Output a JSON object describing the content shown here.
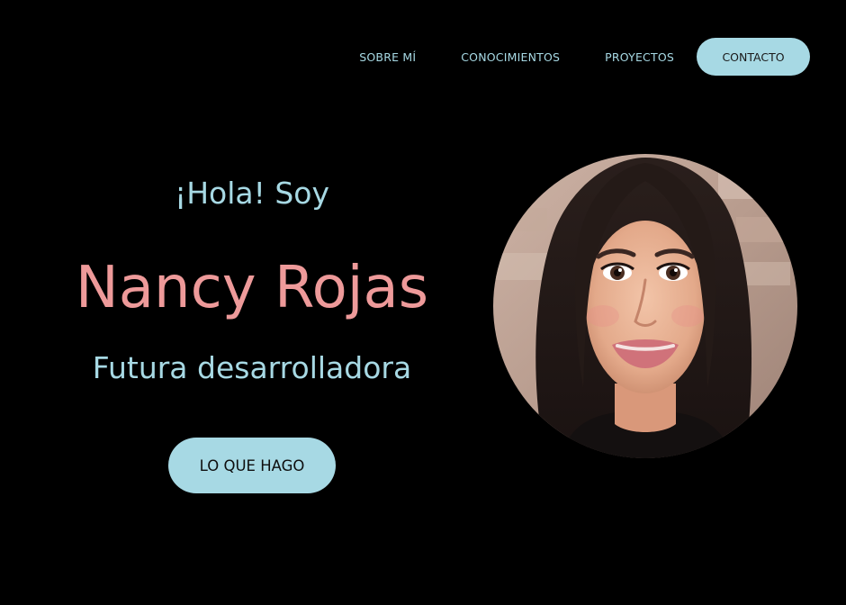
{
  "nav": {
    "items": [
      {
        "label": "SOBRE MÍ"
      },
      {
        "label": "CONOCIMIENTOS"
      },
      {
        "label": "PROYECTOS"
      }
    ],
    "contact_label": "CONTACTO"
  },
  "hero": {
    "greeting": "¡Hola! Soy",
    "name": "Nancy Rojas",
    "role": "Futura desarrolladora",
    "button_label": "LO QUE HAGO"
  },
  "colors": {
    "background": "#000000",
    "accent_blue": "#a7d9e4",
    "accent_pink": "#ee9a9a"
  },
  "icons": {
    "profile": "profile-photo"
  }
}
